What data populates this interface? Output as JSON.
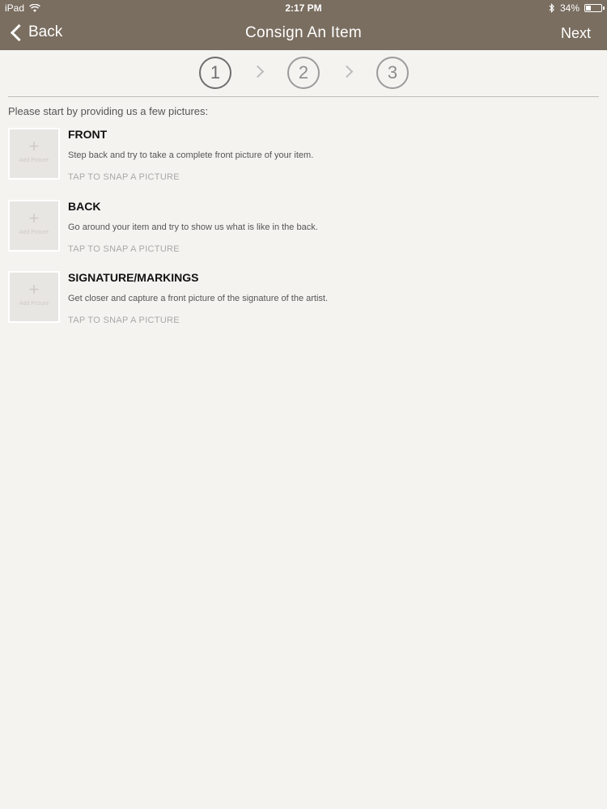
{
  "status_bar": {
    "device": "iPad",
    "time": "2:17 PM",
    "battery_percent": "34%",
    "battery_level": 0.34,
    "wifi_icon": "wifi-icon",
    "bluetooth_icon": "bluetooth-icon"
  },
  "nav": {
    "back_label": "Back",
    "title": "Consign An Item",
    "next_label": "Next"
  },
  "steps": [
    "1",
    "2",
    "3"
  ],
  "active_step": 1,
  "intro": "Please start by providing us a few pictures:",
  "items": [
    {
      "title": "FRONT",
      "description": "Step back and try to take a complete front picture of your item.",
      "action": "TAP TO SNAP A PICTURE",
      "thumb_label": "Add Picture"
    },
    {
      "title": "BACK",
      "description": "Go around your item and try to show us what is like in the back.",
      "action": "TAP TO SNAP A PICTURE",
      "thumb_label": "Add Picture"
    },
    {
      "title": "SIGNATURE/MARKINGS",
      "description": "Get closer and capture a front picture of the signature of the artist.",
      "action": "TAP TO SNAP A PICTURE",
      "thumb_label": "Add Picture"
    }
  ],
  "colors": {
    "nav_background": "#7a6e60",
    "page_background": "#f4f3f0"
  }
}
